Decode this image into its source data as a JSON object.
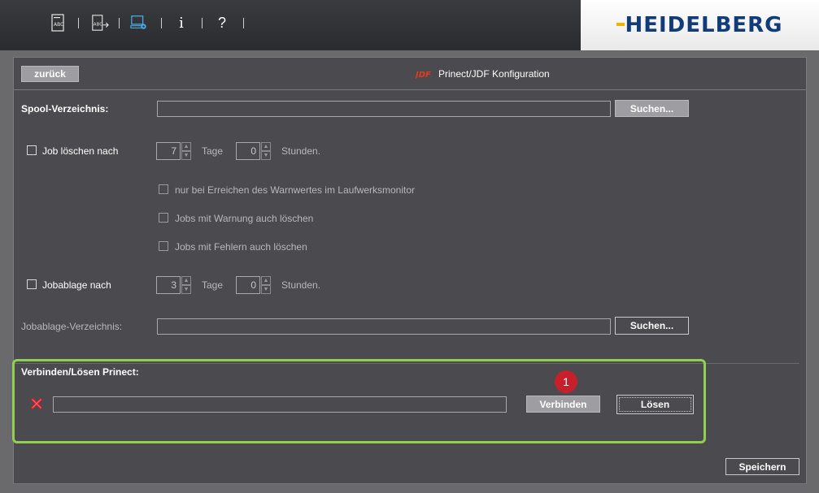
{
  "toolbar": {
    "icons": [
      "abc-document-icon",
      "abc-export-icon",
      "computer-settings-icon",
      "info-icon",
      "help-icon"
    ],
    "info_glyph": "i",
    "help_glyph": "?"
  },
  "logo": {
    "text": "HEIDELBERG"
  },
  "header": {
    "back_label": "zurück",
    "title": "Prinect/JDF Konfiguration",
    "jdf_icon_text": "JDF"
  },
  "spool": {
    "label": "Spool-Verzeichnis:",
    "value": "",
    "search_label": "Suchen..."
  },
  "job_delete": {
    "label": "Job löschen nach",
    "days_value": "7",
    "days_unit": "Tage",
    "hours_value": "0",
    "hours_unit": "Stunden.",
    "option1": "nur bei Erreichen des Warnwertes im Laufwerksmonitor",
    "option2": "Jobs mit Warnung auch löschen",
    "option3": "Jobs mit Fehlern auch löschen"
  },
  "job_archive": {
    "label": "Jobablage nach",
    "days_value": "3",
    "days_unit": "Tage",
    "hours_value": "0",
    "hours_unit": "Stunden.",
    "dir_label": "Jobablage-Verzeichnis:",
    "dir_value": "",
    "search_label": "Suchen..."
  },
  "connect": {
    "section_label": "Verbinden/Lösen Prinect:",
    "status_icon": "error-x-icon",
    "value": "",
    "connect_label": "Verbinden",
    "disconnect_label": "Lösen",
    "callout_number": "1"
  },
  "footer": {
    "save_label": "Speichern"
  },
  "colors": {
    "highlight": "#8fd14f",
    "badge": "#c8202a",
    "brand": "#123b7a"
  }
}
